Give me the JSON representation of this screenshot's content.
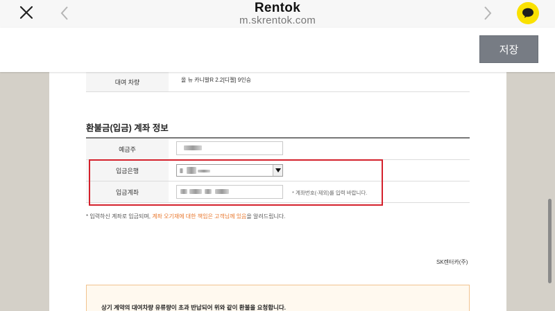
{
  "browser": {
    "title": "Rentok",
    "url": "m.skrentok.com"
  },
  "toolbar": {
    "save_label": "저장"
  },
  "form": {
    "vehicle_label": "대여 차량",
    "vehicle_value": "올 뉴 카니발R 2.2[디젤] 9인승",
    "section_title": "환불금(입금) 계좌 정보",
    "depositor_label": "예금주",
    "bank_label": "입금은행",
    "account_label": "입금계좌",
    "account_hint": "* 계좌번호(-제외)를 입력 바랍니다.",
    "note_prefix": "* 입력하신 계좌로 입금되며, ",
    "note_highlight": "계좌 오기재에 대한 책임은 고객님께 있음",
    "note_suffix": "을 알려드립니다."
  },
  "company": "SK렌터카(주)",
  "notice": {
    "text": "상기 계약의 대여차량 유류량이 초과 반납되어 위와 같이 환불을 요청합니다."
  },
  "colors": {
    "accent_orange": "#e8762b",
    "highlight_red": "#d4202b",
    "save_button": "#777c84",
    "kakao_yellow": "#fae100"
  }
}
